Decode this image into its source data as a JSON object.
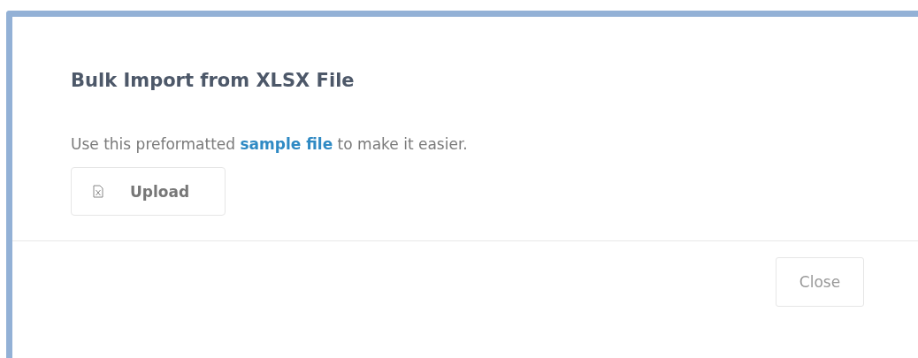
{
  "dialog": {
    "title": "Bulk Import from XLSX File",
    "body": {
      "text_before": "Use this preformatted ",
      "link": "sample file",
      "text_after": " to make it easier."
    },
    "upload_button": {
      "label": "Upload"
    },
    "footer_buttons": [
      "Close"
    ]
  }
}
